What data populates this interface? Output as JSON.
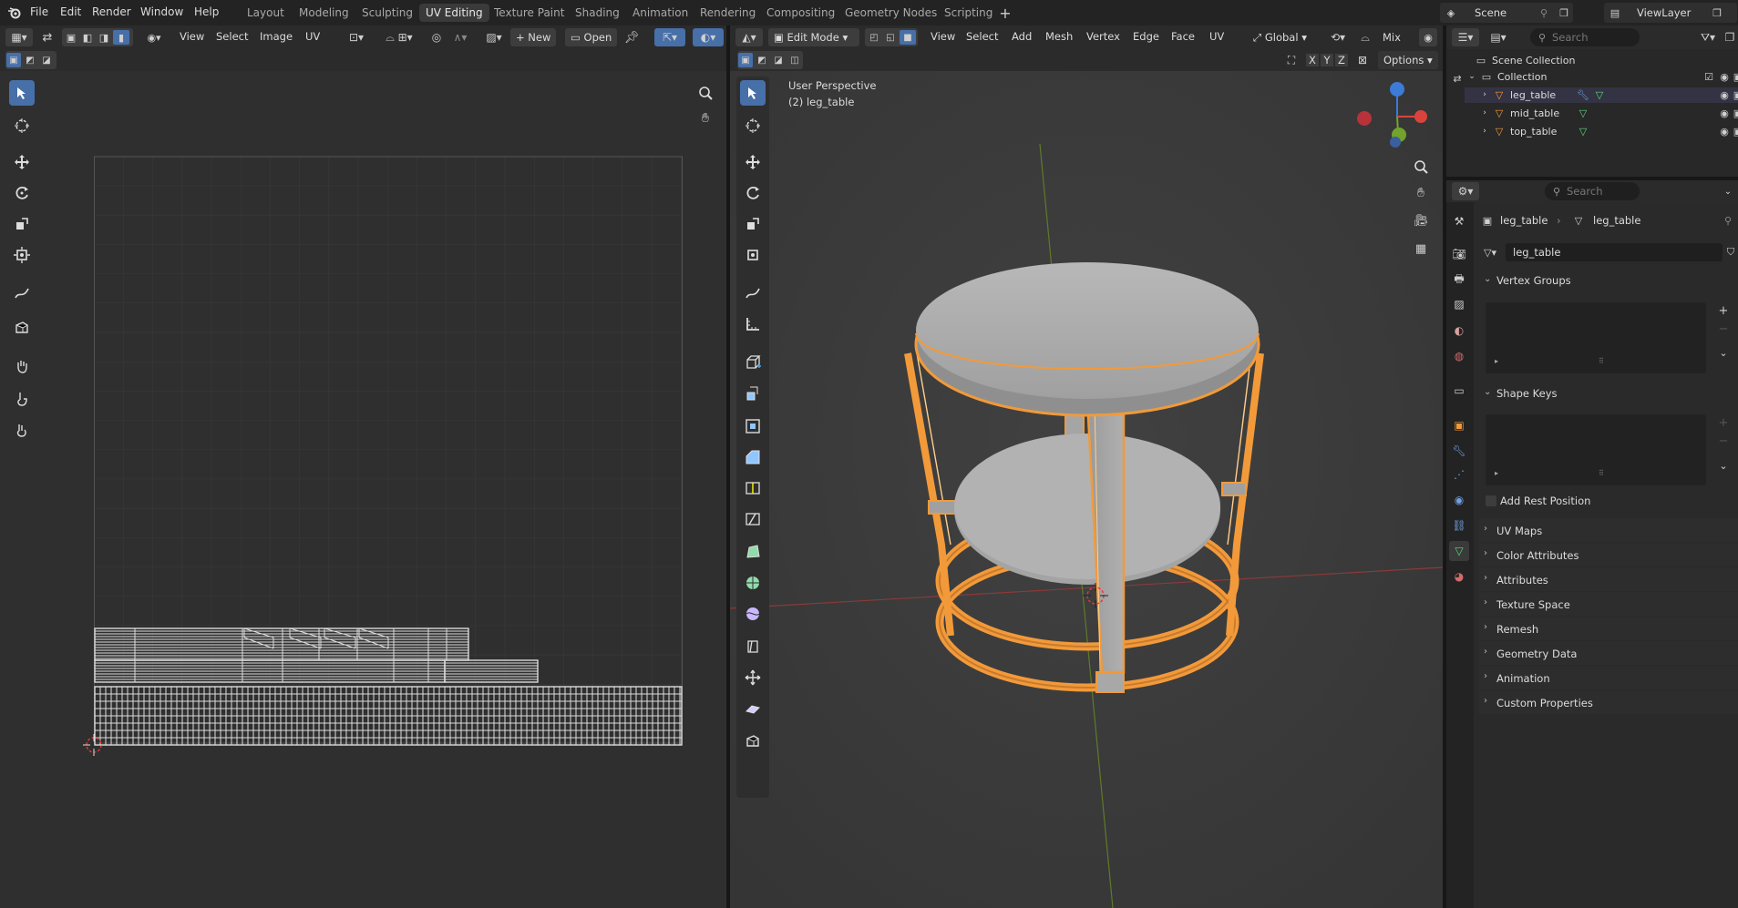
{
  "topbar": {
    "menus": [
      "File",
      "Edit",
      "Render",
      "Window",
      "Help"
    ],
    "workspaces": [
      "Layout",
      "Modeling",
      "Sculpting",
      "UV Editing",
      "Texture Paint",
      "Shading",
      "Animation",
      "Rendering",
      "Compositing",
      "Geometry Nodes",
      "Scripting"
    ],
    "active_workspace": "UV Editing",
    "scene": "Scene",
    "view_layer": "ViewLayer"
  },
  "uv_editor": {
    "menus": [
      "View",
      "Select",
      "Image",
      "UV"
    ],
    "new_label": "New",
    "open_label": "Open"
  },
  "viewport": {
    "mode": "Edit Mode",
    "menus": [
      "View",
      "Select",
      "Add",
      "Mesh",
      "Vertex",
      "Edge",
      "Face",
      "UV"
    ],
    "orientation": "Global",
    "snap_mix": "Mix",
    "axes": [
      "X",
      "Y",
      "Z"
    ],
    "options_label": "Options",
    "perspective_label": "User Perspective",
    "object_label": "(2) leg_table"
  },
  "outliner": {
    "search_placeholder": "Search",
    "scene_collection": "Scene Collection",
    "collection": "Collection",
    "objects": [
      "leg_table",
      "mid_table",
      "top_table"
    ]
  },
  "properties": {
    "search_placeholder": "Search",
    "breadcrumb_object": "leg_table",
    "breadcrumb_mesh": "leg_table",
    "mesh_name": "leg_table",
    "vertex_groups": "Vertex Groups",
    "shape_keys": "Shape Keys",
    "add_rest_position": "Add Rest Position",
    "panels": [
      "UV Maps",
      "Color Attributes",
      "Attributes",
      "Texture Space",
      "Remesh",
      "Geometry Data",
      "Animation",
      "Custom Properties"
    ]
  },
  "colors": {
    "accent": "#476fa8",
    "select_orange": "#f29a3a"
  }
}
